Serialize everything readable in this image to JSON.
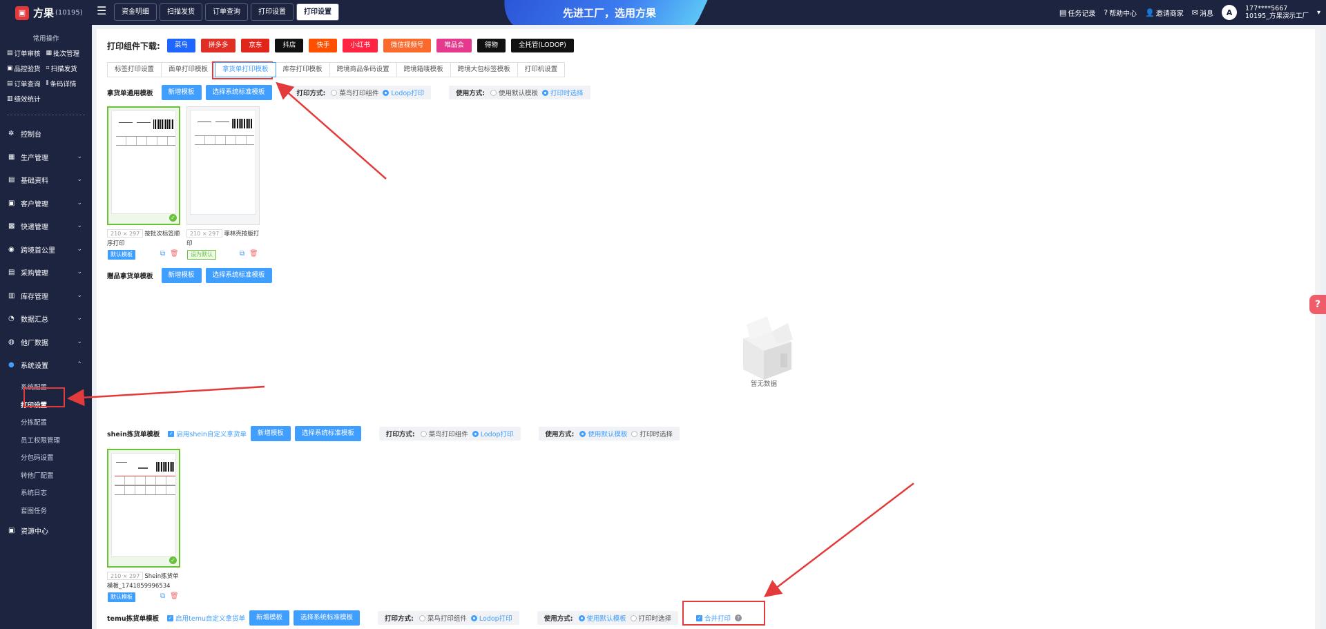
{
  "app": {
    "name": "方果",
    "id": "(10195)"
  },
  "top_tabs": [
    "资金明细",
    "扫描发货",
    "订单查询",
    "打印设置",
    "打印设置"
  ],
  "slogan": "先进工厂，选用方果",
  "top_right": {
    "task": "任务记录",
    "help": "帮助中心",
    "invite": "邀请商家",
    "message": "消息",
    "avatar": "A",
    "user_phone": "177****5667",
    "user_factory": "10195_方果演示工厂"
  },
  "sidebar": {
    "quick_title": "常用操作",
    "quick": [
      "订单审核",
      "批次管理",
      "品控验货",
      "扫描发货",
      "订单查询",
      "条码详情",
      "绩效统计"
    ],
    "menu": [
      {
        "label": "控制台",
        "icon": "dashboard-icon"
      },
      {
        "label": "生产管理",
        "icon": "production-icon"
      },
      {
        "label": "基础资料",
        "icon": "database-icon"
      },
      {
        "label": "客户管理",
        "icon": "customer-icon"
      },
      {
        "label": "快递管理",
        "icon": "express-icon"
      },
      {
        "label": "跨境首公里",
        "icon": "globe-icon"
      },
      {
        "label": "采购管理",
        "icon": "purchase-icon"
      },
      {
        "label": "库存管理",
        "icon": "inventory-icon"
      },
      {
        "label": "数据汇总",
        "icon": "chart-icon"
      },
      {
        "label": "他厂数据",
        "icon": "factory-icon"
      },
      {
        "label": "系统设置",
        "icon": "settings-icon"
      }
    ],
    "submenu": [
      "系统配置",
      "打印设置",
      "分拣配置",
      "员工权限管理",
      "分包码设置",
      "转他厂配置",
      "系统日志",
      "套图任务"
    ],
    "resource": "资源中心"
  },
  "content": {
    "download_label": "打印组件下载:",
    "download_buttons": [
      {
        "label": "菜鸟",
        "color": "#1e66ff"
      },
      {
        "label": "拼多多",
        "color": "#e02e24"
      },
      {
        "label": "京东",
        "color": "#e1251b"
      },
      {
        "label": "抖店",
        "color": "#111111"
      },
      {
        "label": "快手",
        "color": "#ff5000"
      },
      {
        "label": "小红书",
        "color": "#ff2442"
      },
      {
        "label": "微信视频号",
        "color": "#fa6a2c"
      },
      {
        "label": "唯品会",
        "color": "#e4398d"
      },
      {
        "label": "得物",
        "color": "#111111"
      },
      {
        "label": "全托管(LODOP)",
        "color": "#111111"
      }
    ],
    "subtabs": [
      "标签打印设置",
      "面单打印模板",
      "拿货单打印模板",
      "库存打印模板",
      "跨境商品条码设置",
      "跨境箱唛模板",
      "跨境大包标签模板",
      "打印机设置"
    ],
    "general": {
      "label": "拿货单通用模板",
      "add": "新增模板",
      "choose": "选择系统标准模板",
      "print_method_label": "打印方式:",
      "print_opt1": "菜鸟打印组件",
      "print_opt2": "Lodop打印",
      "use_label": "使用方式:",
      "use_opt1": "使用默认模板",
      "use_opt2": "打印时选择"
    },
    "cards": [
      {
        "size": "210 × 297",
        "name": "按批次标签顺序打印",
        "tag": "默认模板"
      },
      {
        "size": "210 × 297",
        "name": "菲林壳按版打印",
        "tag": "设为默认"
      }
    ],
    "gift": {
      "label": "赠品拿货单模板",
      "add": "新增模板",
      "choose": "选择系统标准模板"
    },
    "empty": "暂无数据",
    "shein": {
      "label": "shein拣货单模板",
      "enable": "启用shein自定义拿货单",
      "add": "新增模板",
      "choose": "选择系统标准模板",
      "print_method_label": "打印方式:",
      "print_opt1": "菜鸟打印组件",
      "print_opt2": "Lodop打印",
      "use_label": "使用方式:",
      "use_opt1": "使用默认模板",
      "use_opt2": "打印时选择",
      "card": {
        "size": "210 × 297",
        "name": "Shein拣货单模板_1741859996534",
        "tag": "默认模板"
      }
    },
    "temu": {
      "label": "temu拣货单模板",
      "enable": "启用temu自定义拿货单",
      "add": "新增模板",
      "choose": "选择系统标准模板",
      "print_method_label": "打印方式:",
      "print_opt1": "菜鸟打印组件",
      "print_opt2": "Lodop打印",
      "use_label": "使用方式:",
      "use_opt1": "使用默认模板",
      "use_opt2": "打印时选择",
      "merge": "合并打印"
    }
  }
}
